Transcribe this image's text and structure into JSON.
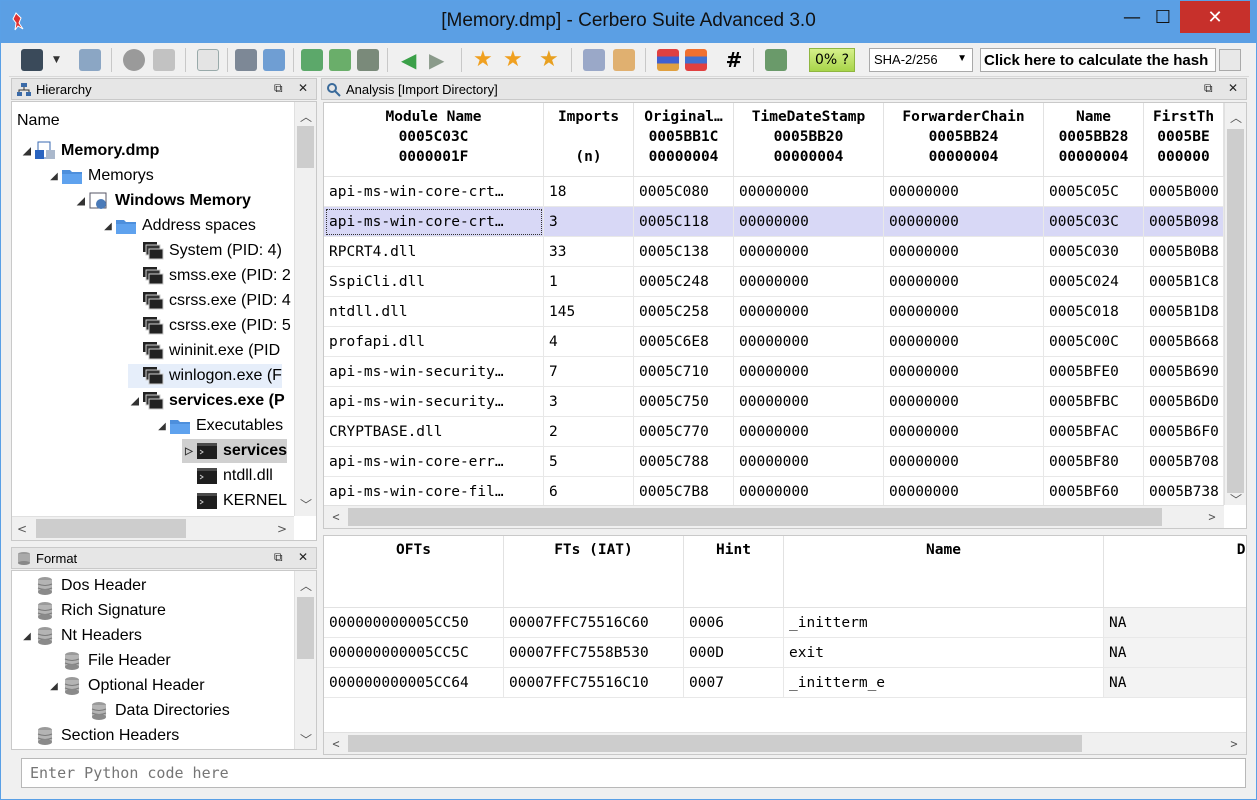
{
  "window": {
    "title": "[Memory.dmp] - Cerbero Suite Advanced 3.0",
    "minimize": "—",
    "maximize": "☐",
    "close": "✕"
  },
  "toolbar": {
    "progress_label": "0% ?",
    "hash_algo": "SHA-2/256",
    "hash_button": "Click here to calculate the hash"
  },
  "hierarchy": {
    "title": "Hierarchy",
    "column": "Name",
    "items": [
      {
        "label": "Memory.dmp",
        "level": 0,
        "bold": true,
        "exp": "◢",
        "icon": "file-icon"
      },
      {
        "label": "Memorys",
        "level": 1,
        "bold": false,
        "exp": "◢",
        "icon": "folder-icon"
      },
      {
        "label": "Windows Memory",
        "level": 2,
        "bold": true,
        "exp": "◢",
        "icon": "memory-icon"
      },
      {
        "label": "Address spaces",
        "level": 3,
        "bold": false,
        "exp": "◢",
        "icon": "folder-icon"
      },
      {
        "label": "System (PID: 4)",
        "level": 4,
        "bold": false,
        "exp": "",
        "icon": "process-icon"
      },
      {
        "label": "smss.exe (PID: 2",
        "level": 4,
        "bold": false,
        "exp": "",
        "icon": "process-icon"
      },
      {
        "label": "csrss.exe (PID: 4",
        "level": 4,
        "bold": false,
        "exp": "",
        "icon": "process-icon"
      },
      {
        "label": "csrss.exe (PID: 5",
        "level": 4,
        "bold": false,
        "exp": "",
        "icon": "process-icon"
      },
      {
        "label": "wininit.exe (PID",
        "level": 4,
        "bold": false,
        "exp": "",
        "icon": "process-icon"
      },
      {
        "label": "winlogon.exe (F",
        "level": 4,
        "bold": false,
        "exp": "",
        "icon": "process-icon"
      },
      {
        "label": "services.exe (P",
        "level": 4,
        "bold": true,
        "exp": "◢",
        "icon": "process-icon"
      },
      {
        "label": "Executables",
        "level": 5,
        "bold": false,
        "exp": "◢",
        "icon": "folder-icon"
      },
      {
        "label": "services",
        "level": 6,
        "bold": true,
        "exp": "▷",
        "icon": "exe-icon"
      },
      {
        "label": "ntdll.dll",
        "level": 6,
        "bold": false,
        "exp": "",
        "icon": "exe-icon"
      },
      {
        "label": "KERNEL",
        "level": 6,
        "bold": false,
        "exp": "",
        "icon": "exe-icon"
      }
    ]
  },
  "format": {
    "title": "Format",
    "items": [
      {
        "label": "Dos Header",
        "level": 0,
        "exp": ""
      },
      {
        "label": "Rich Signature",
        "level": 0,
        "exp": ""
      },
      {
        "label": "Nt Headers",
        "level": 0,
        "exp": "◢"
      },
      {
        "label": "File Header",
        "level": 1,
        "exp": ""
      },
      {
        "label": "Optional Header",
        "level": 1,
        "exp": "◢"
      },
      {
        "label": "Data Directories",
        "level": 2,
        "exp": ""
      },
      {
        "label": "Section Headers",
        "level": 0,
        "exp": ""
      }
    ]
  },
  "analysis": {
    "title": "Analysis [Import Directory]",
    "columns": [
      {
        "name": "Module Name",
        "l2": "0005C03C",
        "l3": "0000001F"
      },
      {
        "name": "Imports",
        "l2": "",
        "l3": "(n)"
      },
      {
        "name": "Original…",
        "l2": "0005BB1C",
        "l3": "00000004"
      },
      {
        "name": "TimeDateStamp",
        "l2": "0005BB20",
        "l3": "00000004"
      },
      {
        "name": "ForwarderChain",
        "l2": "0005BB24",
        "l3": "00000004"
      },
      {
        "name": "Name",
        "l2": "0005BB28",
        "l3": "00000004"
      },
      {
        "name": "FirstTh",
        "l2": "0005BE",
        "l3": "000000"
      }
    ],
    "rows": [
      [
        "api-ms-win-core-crt…",
        "18",
        "0005C080",
        "00000000",
        "00000000",
        "0005C05C",
        "0005B000"
      ],
      [
        "api-ms-win-core-crt…",
        "3",
        "0005C118",
        "00000000",
        "00000000",
        "0005C03C",
        "0005B098"
      ],
      [
        "RPCRT4.dll",
        "33",
        "0005C138",
        "00000000",
        "00000000",
        "0005C030",
        "0005B0B8"
      ],
      [
        "SspiCli.dll",
        "1",
        "0005C248",
        "00000000",
        "00000000",
        "0005C024",
        "0005B1C8"
      ],
      [
        "ntdll.dll",
        "145",
        "0005C258",
        "00000000",
        "00000000",
        "0005C018",
        "0005B1D8"
      ],
      [
        "profapi.dll",
        "4",
        "0005C6E8",
        "00000000",
        "00000000",
        "0005C00C",
        "0005B668"
      ],
      [
        "api-ms-win-security…",
        "7",
        "0005C710",
        "00000000",
        "00000000",
        "0005BFE0",
        "0005B690"
      ],
      [
        "api-ms-win-security…",
        "3",
        "0005C750",
        "00000000",
        "00000000",
        "0005BFBC",
        "0005B6D0"
      ],
      [
        "CRYPTBASE.dll",
        "2",
        "0005C770",
        "00000000",
        "00000000",
        "0005BFAC",
        "0005B6F0"
      ],
      [
        "api-ms-win-core-err…",
        "5",
        "0005C788",
        "00000000",
        "00000000",
        "0005BF80",
        "0005B708"
      ],
      [
        "api-ms-win-core-fil…",
        "6",
        "0005C7B8",
        "00000000",
        "00000000",
        "0005BF60",
        "0005B738"
      ]
    ],
    "selected_row": 1
  },
  "imports": {
    "columns": [
      "OFTs",
      "FTs (IAT)",
      "Hint",
      "Name",
      "Dem"
    ],
    "rows": [
      [
        "000000000005CC50",
        "00007FFC75516C60",
        "0006",
        "_initterm",
        "NA"
      ],
      [
        "000000000005CC5C",
        "00007FFC7558B530",
        "000D",
        "exit",
        "NA"
      ],
      [
        "000000000005CC64",
        "00007FFC75516C10",
        "0007",
        "_initterm_e",
        "NA"
      ]
    ]
  },
  "python": {
    "placeholder": "Enter Python code here"
  },
  "colors": {
    "titlebar": "#5b9fe4",
    "close": "#c7302b",
    "selection": "#d8d8f6"
  }
}
